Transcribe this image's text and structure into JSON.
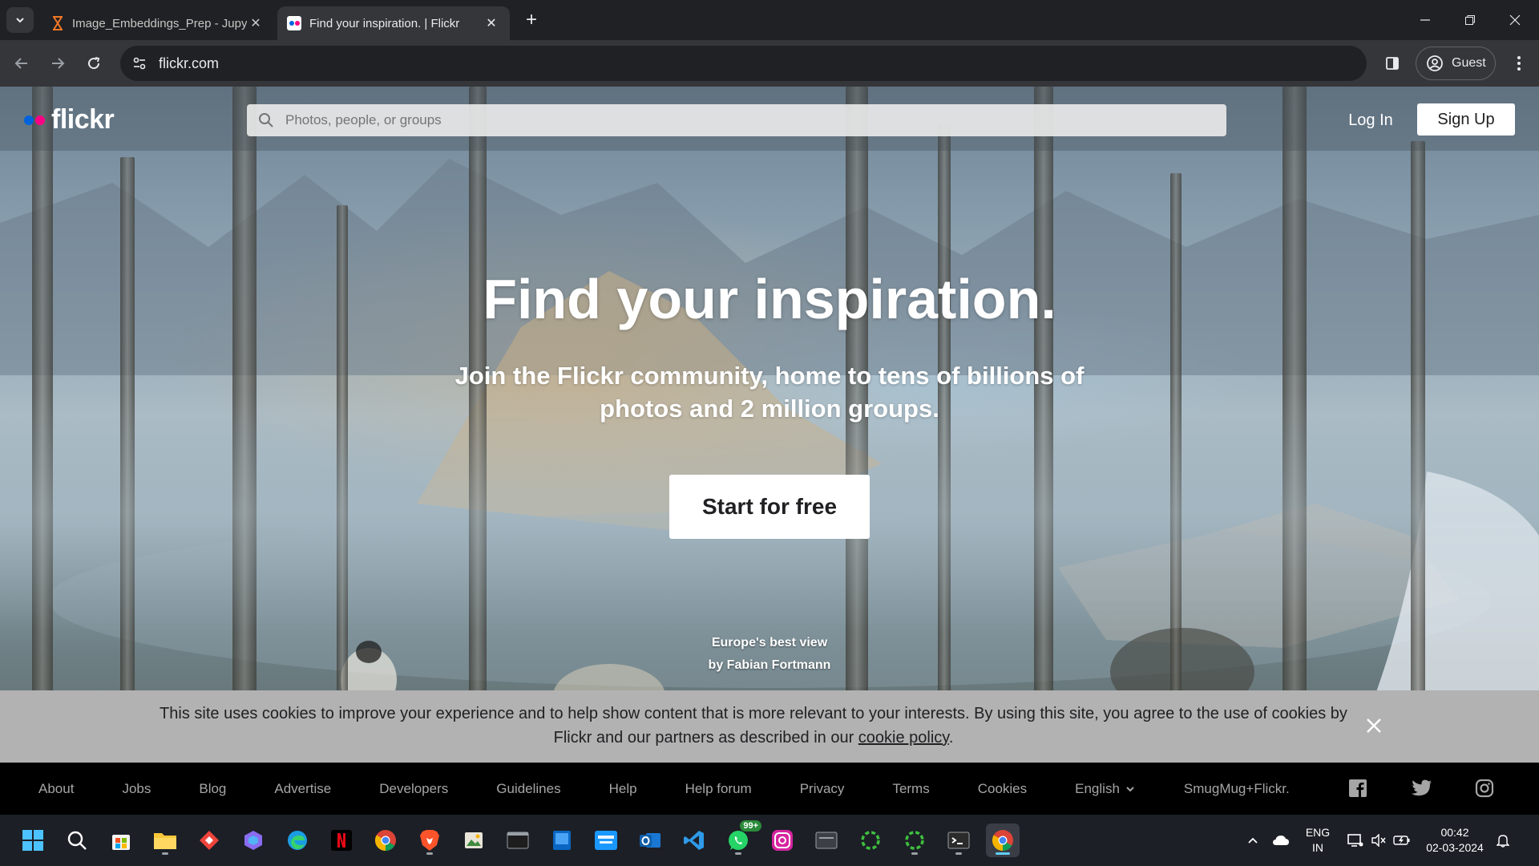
{
  "browser": {
    "tabs": [
      {
        "title": "Image_Embeddings_Prep - Jupyter",
        "icon": "hourglass-icon",
        "active": false
      },
      {
        "title": "Find your inspiration. | Flickr",
        "icon": "flickr-icon",
        "active": true
      }
    ],
    "url": "flickr.com",
    "profile_label": "Guest"
  },
  "header": {
    "logo_text": "flickr",
    "search_placeholder": "Photos, people, or groups",
    "login_label": "Log In",
    "signup_label": "Sign Up",
    "colors": {
      "blue_dot": "#0063dc",
      "pink_dot": "#ff0084"
    }
  },
  "hero": {
    "title": "Find your inspiration.",
    "subtitle": "Join the Flickr community, home to tens of billions of photos and 2 million groups.",
    "cta_label": "Start for free",
    "photo_title": "Europe's best view",
    "photo_author": "by Fabian Fortmann"
  },
  "cookie": {
    "text_before": "This site uses cookies to improve your experience and to help show content that is more relevant to your interests. By using this site, you agree to the use of cookies by Flickr and our partners as described in our ",
    "link_text": "cookie policy",
    "text_after": "."
  },
  "footer": {
    "links": [
      "About",
      "Jobs",
      "Blog",
      "Advertise",
      "Developers",
      "Guidelines",
      "Help",
      "Help forum",
      "Privacy",
      "Terms",
      "Cookies"
    ],
    "language": "English",
    "partner": "SmugMug+Flickr.",
    "social": [
      "facebook-icon",
      "twitter-icon",
      "instagram-icon"
    ]
  },
  "taskbar": {
    "whatsapp_badge": "99+",
    "lang_line1": "ENG",
    "lang_line2": "IN",
    "time": "00:42",
    "date": "02-03-2024"
  }
}
